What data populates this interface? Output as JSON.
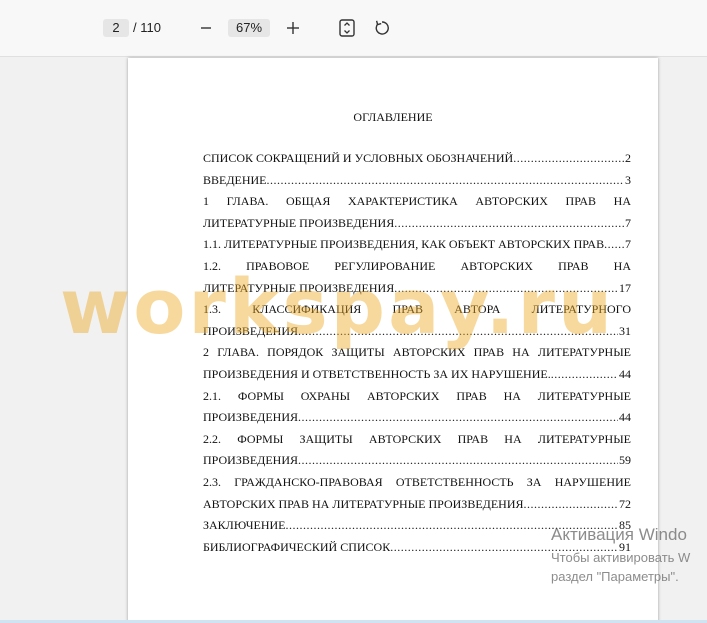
{
  "toolbar": {
    "current_page": "2",
    "total_pages": "/ 110",
    "zoom": "67%",
    "icons": [
      "minus-icon",
      "plus-icon",
      "fit-page-icon",
      "rotate-icon"
    ]
  },
  "document": {
    "title": "ОГЛАВЛЕНИЕ",
    "entries": [
      {
        "lines": [],
        "last": "СПИСОК СОКРАЩЕНИЙ И УСЛОВНЫХ ОБОЗНАЧЕНИЙ",
        "page": "2"
      },
      {
        "lines": [],
        "last": "ВВЕДЕНИЕ",
        "page": "3"
      },
      {
        "lines": [
          "1 ГЛАВА. ОБЩАЯ ХАРАКТЕРИСТИКА АВТОРСКИХ ПРАВ НА"
        ],
        "last": "ЛИТЕРАТУРНЫЕ ПРОИЗВЕДЕНИЯ",
        "page": "7"
      },
      {
        "lines": [],
        "last": "1.1. ЛИТЕРАТУРНЫЕ ПРОИЗВЕДЕНИЯ, КАК ОБЪЕКТ АВТОРСКИХ ПРАВ",
        "page": "7"
      },
      {
        "lines": [
          "1.2. ПРАВОВОЕ РЕГУЛИРОВАНИЕ АВТОРСКИХ ПРАВ НА"
        ],
        "last": "ЛИТЕРАТУРНЫЕ ПРОИЗВЕДЕНИЯ",
        "page": "17"
      },
      {
        "lines": [
          "1.3. КЛАССИФИКАЦИЯ ПРАВ АВТОРА ЛИТЕРАТУРНОГО"
        ],
        "last": "ПРОИЗВЕДЕНИЯ",
        "page": "31"
      },
      {
        "lines": [
          "2 ГЛАВА. ПОРЯДОК ЗАЩИТЫ АВТОРСКИХ ПРАВ НА ЛИТЕРАТУРНЫЕ"
        ],
        "last": "ПРОИЗВЕДЕНИЯ И ОТВЕТСТВЕННОСТЬ ЗА ИХ НАРУШЕНИЕ.",
        "page": "44"
      },
      {
        "lines": [
          "2.1. ФОРМЫ ОХРАНЫ АВТОРСКИХ ПРАВ НА ЛИТЕРАТУРНЫЕ"
        ],
        "last": "ПРОИЗВЕДЕНИЯ",
        "page": "44"
      },
      {
        "lines": [
          "2.2. ФОРМЫ ЗАЩИТЫ АВТОРСКИХ ПРАВ НА ЛИТЕРАТУРНЫЕ"
        ],
        "last": "ПРОИЗВЕДЕНИЯ",
        "page": "59"
      },
      {
        "lines": [
          "2.3. ГРАЖДАНСКО-ПРАВОВАЯ ОТВЕТСТВЕННОСТЬ ЗА НАРУШЕНИЕ"
        ],
        "last": "АВТОРСКИХ ПРАВ НА ЛИТЕРАТУРНЫЕ ПРОИЗВЕДЕНИЯ",
        "page": "72"
      },
      {
        "lines": [],
        "last": "ЗАКЛЮЧЕНИЕ",
        "page": "85"
      },
      {
        "lines": [],
        "last": "БИБЛИОГРАФИЧЕСКИЙ СПИСОК",
        "page": "91"
      }
    ]
  },
  "watermark": "workspay.ru",
  "activation": {
    "line1": "Активация Windo",
    "line2": "Чтобы активировать W",
    "line3": "раздел \"Параметры\"."
  },
  "colors": {
    "watermark": "#eeaa28",
    "toolbar_bg": "#f8f8f8",
    "viewer_bg": "#f1f1f1"
  }
}
